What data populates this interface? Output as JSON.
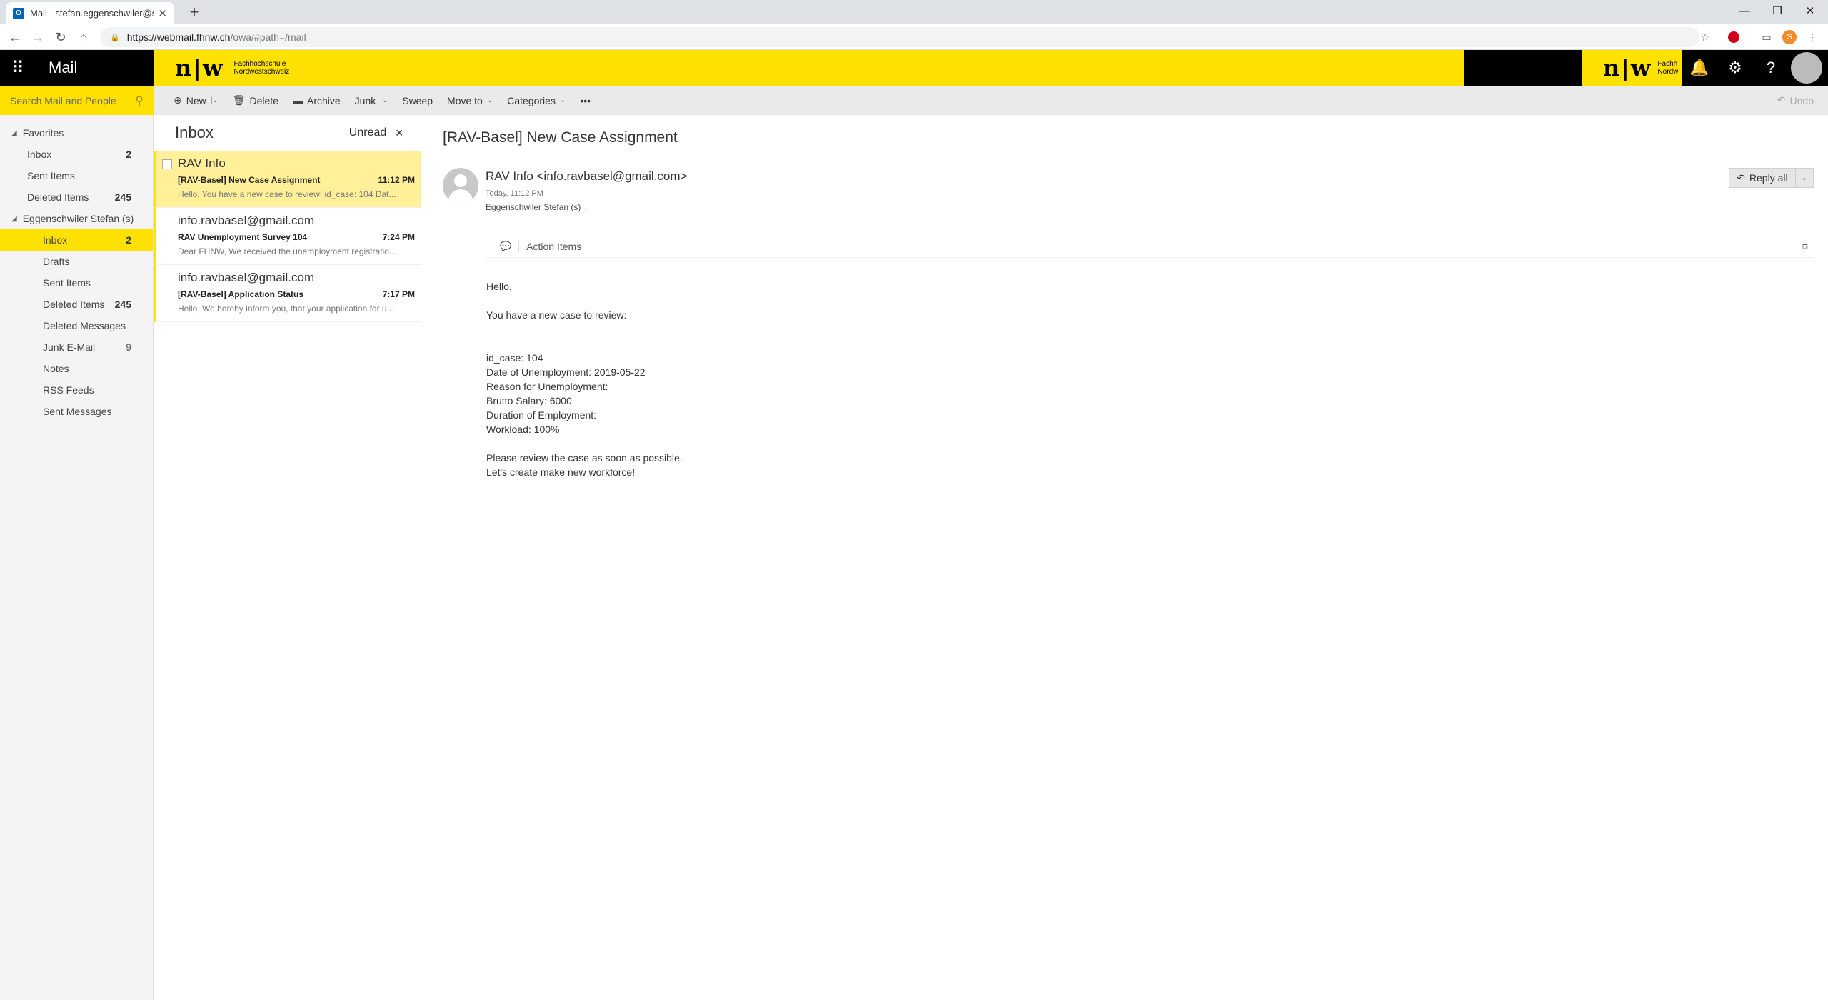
{
  "browser": {
    "tab_title": "Mail - stefan.eggenschwiler@stu",
    "tab_favicon": "O",
    "url_host": "https://webmail.fhnw.ch",
    "url_path": "/owa/#path=/mail",
    "profile_initial": "S"
  },
  "header": {
    "app_name": "Mail",
    "logo_mark": "n|w",
    "logo_line1": "Fachhochschule",
    "logo_line2": "Nordwestschweiz",
    "logo2_line1": "Fachh",
    "logo2_line2": "Nordw",
    "accent_color": "#ffe100"
  },
  "search": {
    "placeholder": "Search Mail and People"
  },
  "toolbar": {
    "new": "New",
    "delete": "Delete",
    "archive": "Archive",
    "junk": "Junk",
    "sweep": "Sweep",
    "move_to": "Move to",
    "categories": "Categories",
    "more": "•••",
    "undo": "Undo"
  },
  "folders": {
    "favorites_label": "Favorites",
    "favorites": [
      {
        "label": "Inbox",
        "count": "2"
      },
      {
        "label": "Sent Items",
        "count": ""
      },
      {
        "label": "Deleted Items",
        "count": "245"
      }
    ],
    "account_label": "Eggenschwiler Stefan (s)",
    "account": [
      {
        "label": "Inbox",
        "count": "2"
      },
      {
        "label": "Drafts",
        "count": ""
      },
      {
        "label": "Sent Items",
        "count": ""
      },
      {
        "label": "Deleted Items",
        "count": "245"
      },
      {
        "label": "Deleted Messages",
        "count": ""
      },
      {
        "label": "Junk E-Mail",
        "count": "9"
      },
      {
        "label": "Notes",
        "count": ""
      },
      {
        "label": "RSS Feeds",
        "count": ""
      },
      {
        "label": "Sent Messages",
        "count": ""
      }
    ]
  },
  "list": {
    "title": "Inbox",
    "filter": "Unread",
    "messages": [
      {
        "from": "RAV Info",
        "subject": "[RAV-Basel] New Case Assignment",
        "time": "11:12 PM",
        "preview": "Hello,  You have a new case to review:   id_case: 104 Dat..."
      },
      {
        "from": "info.ravbasel@gmail.com",
        "subject": "RAV Unemployment Survey 104",
        "time": "7:24 PM",
        "preview": "Dear FHNW,  We received the unemployment registratio..."
      },
      {
        "from": "info.ravbasel@gmail.com",
        "subject": "[RAV-Basel] Application Status",
        "time": "7:17 PM",
        "preview": "Hello, We hereby inform you, that your application for u..."
      }
    ]
  },
  "reading": {
    "subject": "[RAV-Basel] New Case Assignment",
    "from": "RAV Info <info.ravbasel@gmail.com>",
    "date": "Today, 11:12 PM",
    "to": "Eggenschwiler Stefan (s)",
    "reply_all": "Reply all",
    "action_items": "Action Items",
    "body": {
      "greeting": "Hello,",
      "intro": "You have a new case to review:",
      "id_case": "id_case: 104",
      "date_unemployment": "Date of Unemployment: 2019-05-22",
      "reason": "Reason for Unemployment:",
      "salary": "Brutto Salary: 6000",
      "duration": "Duration of Employment:",
      "workload": "Workload: 100%",
      "review": "Please review the case as soon as possible.",
      "closing": "Let's create make new workforce!"
    }
  }
}
